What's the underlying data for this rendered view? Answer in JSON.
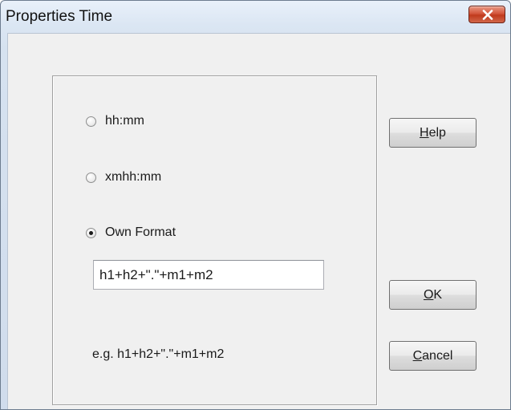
{
  "window": {
    "title": "Properties Time"
  },
  "options": [
    {
      "label": "hh:mm",
      "checked": false
    },
    {
      "label": "xmhh:mm",
      "checked": false
    },
    {
      "label": "Own Format",
      "checked": true
    }
  ],
  "own_format": {
    "value": "h1+h2+\".\"+m1+m2"
  },
  "example_text": "e.g. h1+h2+\".\"+m1+m2",
  "buttons": {
    "help": {
      "mnemonic": "H",
      "rest": "elp"
    },
    "ok": {
      "mnemonic": "O",
      "rest": "K"
    },
    "cancel": {
      "mnemonic": "C",
      "rest": "ancel"
    }
  },
  "icons": {
    "close": "close-x-icon"
  },
  "colors": {
    "close_button": "#c9452a",
    "dialog_background": "#f0f0f0"
  }
}
